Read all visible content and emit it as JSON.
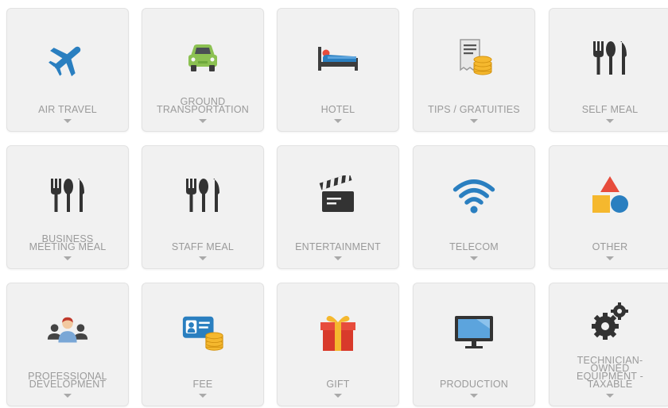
{
  "categories": [
    {
      "label": "AIR TRAVEL",
      "icon": "airplane-icon"
    },
    {
      "label": "GROUND\nTRANSPORTATION",
      "icon": "car-icon"
    },
    {
      "label": "HOTEL",
      "icon": "bed-icon"
    },
    {
      "label": "TIPS / GRATUITIES",
      "icon": "receipt-coins-icon"
    },
    {
      "label": "SELF MEAL",
      "icon": "utensils-icon"
    },
    {
      "label": "BUSINESS\nMEETING MEAL",
      "icon": "utensils-icon"
    },
    {
      "label": "STAFF MEAL",
      "icon": "utensils-icon"
    },
    {
      "label": "ENTERTAINMENT",
      "icon": "clapperboard-icon"
    },
    {
      "label": "TELECOM",
      "icon": "wifi-icon"
    },
    {
      "label": "OTHER",
      "icon": "shapes-icon"
    },
    {
      "label": "PROFESSIONAL\nDEVELOPMENT",
      "icon": "people-icon"
    },
    {
      "label": "FEE",
      "icon": "id-card-coins-icon"
    },
    {
      "label": "GIFT",
      "icon": "gift-icon"
    },
    {
      "label": "PRODUCTION",
      "icon": "monitor-icon"
    },
    {
      "label": "TECHNICIAN-\nOWNED\nEQUIPMENT -\nTAXABLE",
      "icon": "gears-icon"
    }
  ],
  "colors": {
    "tile_bg": "#f1f1f1",
    "label": "#9a9a9a",
    "blue": "#2a7fc0",
    "dark": "#333333",
    "green": "#8cc152",
    "red": "#e74c3c",
    "gold": "#f5b82e"
  }
}
